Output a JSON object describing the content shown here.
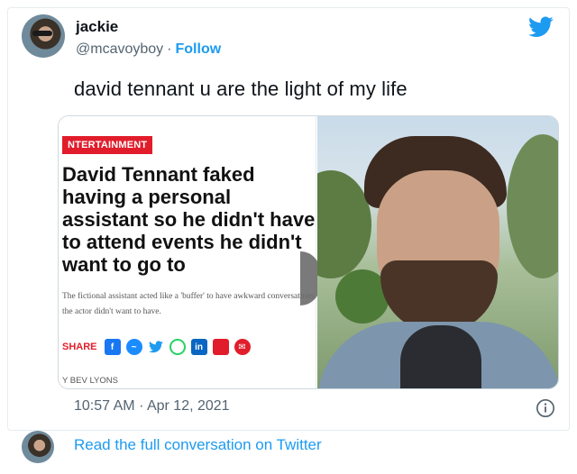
{
  "author": {
    "name": "jackie",
    "handle": "@mcavoyboy",
    "separator": "·",
    "follow_label": "Follow"
  },
  "tweet": {
    "text": "david tennant u are the light of my life",
    "time": "10:57 AM",
    "date_separator": "·",
    "date": "Apr 12, 2021"
  },
  "article": {
    "category": "NTERTAINMENT",
    "headline": "David Tennant faked having a personal assistant so he didn't have to attend events he didn't want to go to",
    "subtext": "The fictional assistant acted like a 'buffer' to have awkward conversations the actor didn't want to have.",
    "share_label": "SHARE",
    "byline": "Y BEV LYONS"
  },
  "footer": {
    "link_text": "Read the full conversation on Twitter"
  },
  "icons": {
    "brand": "twitter-bird-icon",
    "info": "info-icon"
  },
  "colors": {
    "accent": "#1d9bf0",
    "badge_red": "#e11d2b",
    "muted": "#536471"
  }
}
